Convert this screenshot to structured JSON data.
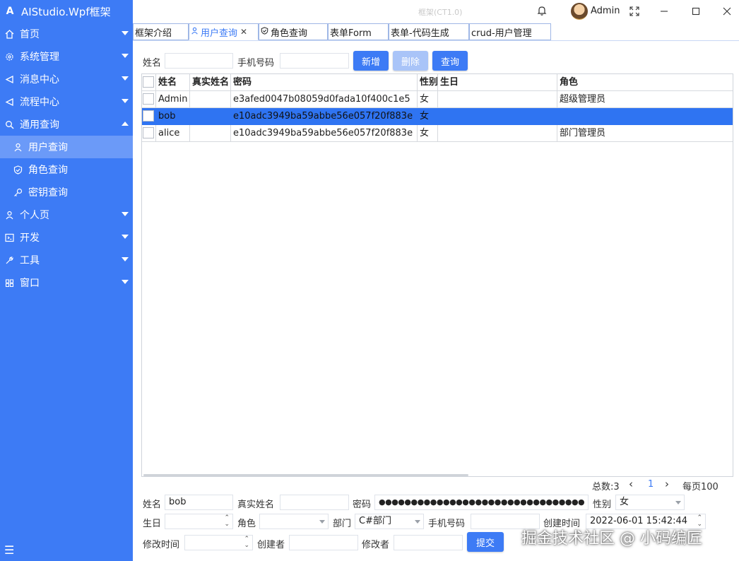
{
  "app": {
    "title": "AIStudio.Wpf框架",
    "window_caption": "框架(CT1.0)",
    "user": "Admin"
  },
  "sidebar": {
    "items": [
      {
        "label": "首页",
        "icon": "home-icon"
      },
      {
        "label": "系统管理",
        "icon": "gear-icon"
      },
      {
        "label": "消息中心",
        "icon": "message-icon"
      },
      {
        "label": "流程中心",
        "icon": "flow-icon"
      },
      {
        "label": "通用查询",
        "icon": "search-icon"
      },
      {
        "label": "用户查询",
        "icon": "user-icon"
      },
      {
        "label": "角色查询",
        "icon": "shield-icon"
      },
      {
        "label": "密钥查询",
        "icon": "key-icon"
      },
      {
        "label": "个人页",
        "icon": "person-icon"
      },
      {
        "label": "开发",
        "icon": "code-icon"
      },
      {
        "label": "工具",
        "icon": "wrench-icon"
      },
      {
        "label": "窗口",
        "icon": "windows-icon"
      }
    ],
    "menu_glyph": "☰"
  },
  "tabs": [
    {
      "label": "框架介绍"
    },
    {
      "label": "用户查询",
      "close": "✕"
    },
    {
      "label": "角色查询"
    },
    {
      "label": "表单Form"
    },
    {
      "label": "表单-代码生成"
    },
    {
      "label": "crud-用户管理"
    }
  ],
  "search": {
    "name_label": "姓名",
    "name_value": "",
    "phone_label": "手机号码",
    "phone_value": "",
    "add_label": "新增",
    "delete_label": "删除",
    "query_label": "查询"
  },
  "grid": {
    "columns": [
      "姓名",
      "真实姓名",
      "密码",
      "性别",
      "生日",
      "角色"
    ],
    "rows": [
      {
        "name": "Admin",
        "real_name": "",
        "password": "e3afed0047b08059d0fada10f400c1e5",
        "gender": "女",
        "birthday": "",
        "role": "超级管理员"
      },
      {
        "name": "bob",
        "real_name": "",
        "password": "e10adc3949ba59abbe56e057f20f883e",
        "gender": "女",
        "birthday": "",
        "role": ""
      },
      {
        "name": "alice",
        "real_name": "",
        "password": "e10adc3949ba59abbe56e057f20f883e",
        "gender": "女",
        "birthday": "",
        "role": "部门管理员"
      }
    ]
  },
  "pager": {
    "total": "总数:3",
    "prev": "‹",
    "page": "1",
    "next": "›",
    "page_size": "每页100"
  },
  "form": {
    "name_label": "姓名",
    "name_value": "bob",
    "real_name_label": "真实姓名",
    "real_name_value": "",
    "password_label": "密码",
    "password_value": "●●●●●●●●●●●●●●●●●●●●●●●●●●●●●●●●",
    "gender_label": "性别",
    "gender_value": "女",
    "birthday_label": "生日",
    "birthday_value": "",
    "role_label": "角色",
    "role_value": "",
    "dept_label": "部门",
    "dept_value": "C#部门",
    "phone_label": "手机号码",
    "phone_value": "",
    "created_time_label": "创建时间",
    "created_time_value": "2022-06-01 15:42:44",
    "modified_time_label": "修改时间",
    "modified_time_value": "",
    "creator_label": "创建者",
    "creator_value": "",
    "modifier_label": "修改者",
    "modifier_value": "",
    "submit_label": "提交"
  },
  "watermark": "掘金技术社区 @ 小码编匠",
  "colors": {
    "accent": "#3d7bf5",
    "selected_row": "#2f74f2",
    "sidebar_active": "#6b9af8"
  }
}
